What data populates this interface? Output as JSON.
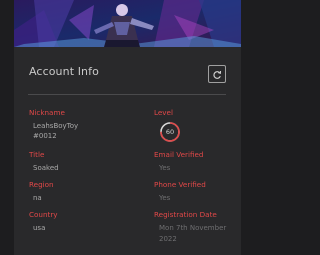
{
  "account": {
    "title": "Account Info",
    "refresh_icon": "refresh-icon"
  },
  "fields": {
    "nickname": {
      "label": "Nickname",
      "value_line1": "LeahsBoyToy",
      "value_line2": "#0012"
    },
    "title": {
      "label": "Title",
      "value": "Soaked"
    },
    "region": {
      "label": "Region",
      "value": "na"
    },
    "country": {
      "label": "Country",
      "value": "usa"
    },
    "level": {
      "label": "Level",
      "value": "60",
      "progress": 0.75
    },
    "email_verified": {
      "label": "Email Verified",
      "value": "Yes"
    },
    "phone_verified": {
      "label": "Phone Verified",
      "value": "Yes"
    },
    "registration_date": {
      "label": "Registration Date",
      "value_line1": "Mon 7th November",
      "value_line2": "2022"
    }
  },
  "colors": {
    "accent": "#e04848",
    "card_bg": "#29292b",
    "page_bg": "#1d1d1f"
  }
}
